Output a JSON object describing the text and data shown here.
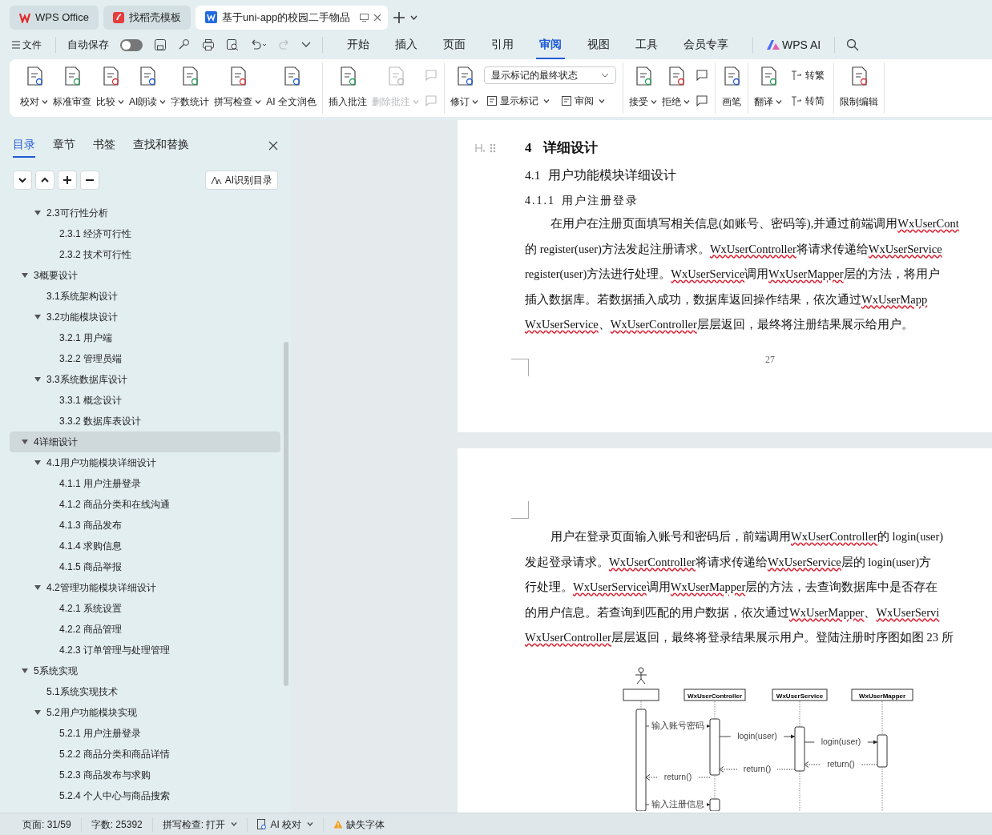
{
  "app_tabs": [
    {
      "label": "WPS Office",
      "selected": false,
      "kind": "home"
    },
    {
      "label": "找稻壳模板",
      "selected": false,
      "kind": "template"
    },
    {
      "label": "基于uni-app的校园二手物品",
      "selected": true,
      "kind": "doc"
    }
  ],
  "menu": {
    "file": "文件",
    "autosave": {
      "label": "自动保存",
      "on": false
    },
    "ribbon_tabs": [
      {
        "label": "开始",
        "selected": false
      },
      {
        "label": "插入",
        "selected": false
      },
      {
        "label": "页面",
        "selected": false
      },
      {
        "label": "引用",
        "selected": false
      },
      {
        "label": "审阅",
        "selected": true
      },
      {
        "label": "视图",
        "selected": false
      },
      {
        "label": "工具",
        "selected": false
      },
      {
        "label": "会员专享",
        "selected": false
      }
    ],
    "ai": "WPS AI"
  },
  "ribbon": [
    {
      "items": [
        {
          "kind": "large",
          "label": "校对",
          "caret": true,
          "disabled": false
        },
        {
          "kind": "large",
          "label": "标准审查",
          "caret": false,
          "disabled": false
        },
        {
          "kind": "large",
          "label": "比较",
          "caret": true,
          "disabled": false
        },
        {
          "kind": "large",
          "label": "AI朗读",
          "caret": true,
          "disabled": false
        },
        {
          "kind": "large",
          "label": "字数统计",
          "caret": false,
          "disabled": false
        },
        {
          "kind": "large",
          "label": "拼写检查",
          "caret": true,
          "disabled": false
        },
        {
          "kind": "large",
          "label": "AI 全文润色",
          "caret": false,
          "disabled": false
        }
      ]
    },
    {
      "items": [
        {
          "kind": "large",
          "label": "插入批注",
          "caret": false,
          "disabled": false
        },
        {
          "kind": "large",
          "label": "删除批注",
          "caret": true,
          "disabled": true
        },
        {
          "kind": "iconpair",
          "disabled": true
        }
      ]
    },
    {
      "items": [
        {
          "kind": "large",
          "label": "修订",
          "caret": true,
          "disabled": false
        },
        {
          "kind": "dropdown",
          "value": "显示标记的最终状态",
          "small": [
            {
              "label": "显示标记",
              "caret": true
            },
            {
              "label": "审阅",
              "caret": true
            }
          ]
        }
      ]
    },
    {
      "items": [
        {
          "kind": "large",
          "label": "接受",
          "caret": true,
          "disabled": false
        },
        {
          "kind": "large",
          "label": "拒绝",
          "caret": true,
          "disabled": false
        },
        {
          "kind": "iconpair",
          "disabled": false
        }
      ]
    },
    {
      "items": [
        {
          "kind": "large",
          "label": "画笔",
          "caret": false,
          "disabled": false
        }
      ]
    },
    {
      "items": [
        {
          "kind": "large",
          "label": "翻译",
          "caret": true,
          "disabled": false
        },
        {
          "kind": "smallstack",
          "small": [
            {
              "label": "转繁",
              "caret": false
            },
            {
              "label": "转简",
              "caret": false
            }
          ]
        }
      ]
    },
    {
      "items": [
        {
          "kind": "large",
          "label": "限制编辑",
          "caret": false,
          "disabled": false
        }
      ]
    }
  ],
  "sidebar": {
    "tabs": [
      {
        "label": "目录",
        "selected": true
      },
      {
        "label": "章节",
        "selected": false
      },
      {
        "label": "书签",
        "selected": false
      },
      {
        "label": "查找和替换",
        "selected": false
      }
    ],
    "ai_button": "AI识别目录",
    "toc": [
      {
        "children": [
          {
            "label": "2.3可行性分析",
            "expanded": true,
            "selected": false,
            "children": [
              {
                "label": "2.3.1 经济可行性",
                "selected": false
              },
              {
                "label": "2.3.2 技术可行性",
                "selected": false
              }
            ]
          }
        ]
      },
      {
        "label": "3概要设计",
        "expanded": true,
        "selected": false,
        "children": [
          {
            "label": "3.1系统架构设计",
            "selected": false
          },
          {
            "label": "3.2功能模块设计",
            "expanded": true,
            "selected": false,
            "children": [
              {
                "label": "3.2.1 用户端",
                "selected": false
              },
              {
                "label": "3.2.2 管理员端",
                "selected": false
              }
            ]
          },
          {
            "label": "3.3系统数据库设计",
            "expanded": true,
            "selected": false,
            "children": [
              {
                "label": "3.3.1  概念设计",
                "selected": false
              },
              {
                "label": "3.3.2  数据库表设计",
                "selected": false
              }
            ]
          }
        ]
      },
      {
        "label": "4详细设计",
        "expanded": true,
        "selected": true,
        "children": [
          {
            "label": "4.1用户功能模块详细设计",
            "expanded": true,
            "selected": false,
            "children": [
              {
                "label": "4.1.1 用户注册登录",
                "selected": false
              },
              {
                "label": "4.1.2  商品分类和在线沟通",
                "selected": false
              },
              {
                "label": "4.1.3  商品发布",
                "selected": false
              },
              {
                "label": "4.1.4  求购信息",
                "selected": false
              },
              {
                "label": "4.1.5  商品举报",
                "selected": false
              }
            ]
          },
          {
            "label": "4.2管理功能模块详细设计",
            "expanded": true,
            "selected": false,
            "children": [
              {
                "label": "4.2.1  系统设置",
                "selected": false
              },
              {
                "label": "4.2.2  商品管理",
                "selected": false
              },
              {
                "label": "4.2.3  订单管理与处理管理",
                "selected": false
              }
            ]
          }
        ]
      },
      {
        "label": "5系统实现",
        "expanded": true,
        "selected": false,
        "children": [
          {
            "label": "5.1系统实现技术",
            "selected": false
          },
          {
            "label": "5.2用户功能模块实现",
            "expanded": true,
            "selected": false,
            "children": [
              {
                "label": "5.2.1  用户注册登录",
                "selected": false
              },
              {
                "label": "5.2.2  商品分类和商品详情",
                "selected": false
              },
              {
                "label": "5.2.3  商品发布与求购",
                "selected": false
              },
              {
                "label": "5.2.4  个人中心与商品搜索",
                "selected": false
              }
            ]
          }
        ]
      }
    ]
  },
  "document": {
    "page1": {
      "h1": {
        "number": "4",
        "title": "详细设计"
      },
      "h2": {
        "number": "4.1",
        "title": "用户功能模块详细设计"
      },
      "h3": {
        "number": "4.1.1",
        "title": "用户注册登录"
      },
      "lines": [
        [
          {
            "text": "在用户在注册页面填写相关信息(如账号、密码等),并通过前端调用 ",
            "flagged": false
          },
          {
            "text": "WxUserCont",
            "flagged": true
          }
        ],
        [
          {
            "text": "的 register(user)方法发起注册请求。",
            "flagged": false
          },
          {
            "text": "WxUserController",
            "flagged": true
          },
          {
            "text": " 将请求传递给 ",
            "flagged": false
          },
          {
            "text": "WxUserService",
            "flagged": true
          }
        ],
        [
          {
            "text": "register(user)方法进行处理。",
            "flagged": false
          },
          {
            "text": "WxUserService",
            "flagged": true
          },
          {
            "text": " 调用 ",
            "flagged": false
          },
          {
            "text": "WxUserMapper",
            "flagged": true
          },
          {
            "text": " 层的方法，将用户",
            "flagged": false
          }
        ],
        [
          {
            "text": "插入数据库。若数据插入成功，数据库返回操作结果，依次通过 ",
            "flagged": false
          },
          {
            "text": "WxUserMapp",
            "flagged": true
          }
        ],
        [
          {
            "text": "WxUserService",
            "flagged": true
          },
          {
            "text": "、",
            "flagged": false
          },
          {
            "text": "WxUserController",
            "flagged": true
          },
          {
            "text": " 层层返回，最终将注册结果展示给用户。",
            "flagged": false
          }
        ]
      ],
      "page_number": "27"
    },
    "page2": {
      "lines": [
        [
          {
            "text": "用户在登录页面输入账号和密码后，前端调用 ",
            "flagged": false
          },
          {
            "text": "WxUserController",
            "flagged": true
          },
          {
            "text": " 的 login(user)",
            "flagged": false
          }
        ],
        [
          {
            "text": "发起登录请求。",
            "flagged": false
          },
          {
            "text": "WxUserController",
            "flagged": true
          },
          {
            "text": " 将请求传递给 ",
            "flagged": false
          },
          {
            "text": "WxUserService",
            "flagged": true
          },
          {
            "text": " 层的 login(user)方",
            "flagged": false
          }
        ],
        [
          {
            "text": "行处理。",
            "flagged": false
          },
          {
            "text": "WxUserService",
            "flagged": true
          },
          {
            "text": " 调用 ",
            "flagged": false
          },
          {
            "text": "WxUserMapper",
            "flagged": true
          },
          {
            "text": " 层的方法，去查询数据库中是否存在",
            "flagged": false
          }
        ],
        [
          {
            "text": "的用户信息。若查询到匹配的用户数据，依次通过 ",
            "flagged": false
          },
          {
            "text": "WxUserMapper",
            "flagged": true
          },
          {
            "text": "、",
            "flagged": false
          },
          {
            "text": "WxUserServi",
            "flagged": true
          }
        ],
        [
          {
            "text": "WxUserController",
            "flagged": true
          },
          {
            "text": " 层层返回，最终将登录结果展示用户。登陆注册时序图如图 23 所",
            "flagged": false
          }
        ]
      ],
      "diagram": {
        "participants": [
          "WxUserController",
          "WxUserService",
          "WxUserMapper"
        ],
        "messages": [
          {
            "label": "输入账号密码",
            "kind": "call"
          },
          {
            "label": "login(user)",
            "kind": "call"
          },
          {
            "label": "login(user)",
            "kind": "call"
          },
          {
            "label": "return()",
            "kind": "return"
          },
          {
            "label": "return()",
            "kind": "return"
          },
          {
            "label": "return()",
            "kind": "return"
          },
          {
            "label": "输入注册信息",
            "kind": "call"
          }
        ]
      }
    }
  },
  "status_bar": {
    "page": "页面: 31/59",
    "words": "字数: 25392",
    "spell": "拼写检查: 打开",
    "ai_check": "AI 校对",
    "missing_font": "缺失字体"
  }
}
